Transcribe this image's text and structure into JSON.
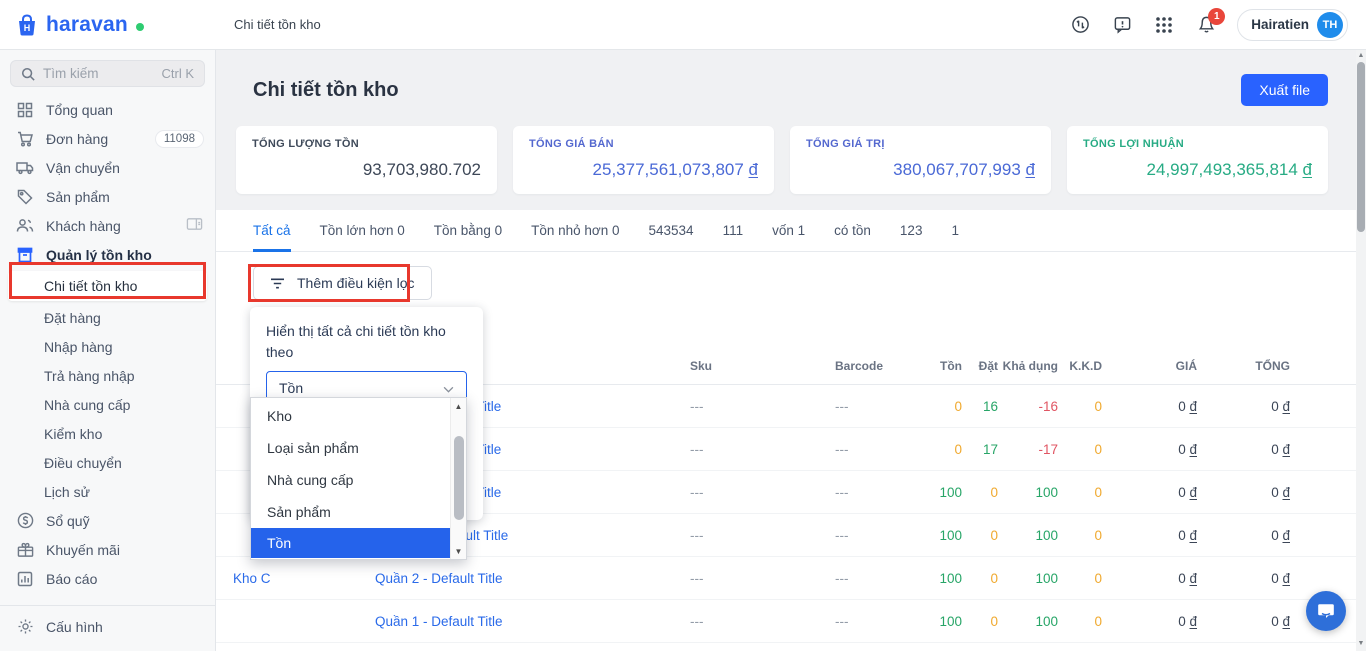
{
  "topbar": {
    "logo_text": "haravan",
    "breadcrumb": "Chi tiết tồn kho",
    "icons": [
      "history-icon",
      "feedback-icon",
      "apps-grid-icon",
      "bell-icon"
    ],
    "notification_count": "1",
    "user_name": "Hairatien",
    "user_initials": "TH"
  },
  "sidebar": {
    "search_placeholder": "Tìm kiếm",
    "search_shortcut": "Ctrl K",
    "items": [
      {
        "label": "Tổng quan",
        "icon": "dashboard-icon"
      },
      {
        "label": "Đơn hàng",
        "icon": "cart-icon",
        "badge": "11098"
      },
      {
        "label": "Vận chuyển",
        "icon": "truck-icon"
      },
      {
        "label": "Sản phẩm",
        "icon": "tag-icon"
      },
      {
        "label": "Khách hàng",
        "icon": "users-icon",
        "trailing_icon": "popout-icon"
      },
      {
        "label": "Quản lý tồn kho",
        "icon": "inventory-icon",
        "parent_active": true
      },
      {
        "label": "Chi tiết tồn kho",
        "child": true,
        "active": true
      },
      {
        "label": "Đặt hàng",
        "child": true
      },
      {
        "label": "Nhập hàng",
        "child": true
      },
      {
        "label": "Trả hàng nhập",
        "child": true
      },
      {
        "label": "Nhà cung cấp",
        "child": true
      },
      {
        "label": "Kiểm kho",
        "child": true
      },
      {
        "label": "Điều chuyển",
        "child": true
      },
      {
        "label": "Lịch sử",
        "child": true
      },
      {
        "label": "Sổ quỹ",
        "icon": "coin-icon"
      },
      {
        "label": "Khuyến mãi",
        "icon": "promo-icon"
      },
      {
        "label": "Báo cáo",
        "icon": "report-icon"
      }
    ],
    "footer_item": {
      "label": "Cấu hình",
      "icon": "gear-icon"
    }
  },
  "page": {
    "title": "Chi tiết tồn kho",
    "export_label": "Xuất file"
  },
  "stats": [
    {
      "label": "TỔNG LƯỢNG TỒN",
      "value": "93,703,980.702",
      "currency": "",
      "label_color": "#3f4a5a",
      "value_color": "#3d4757"
    },
    {
      "label": "TỔNG GIÁ BÁN",
      "value": "25,377,561,073,807",
      "currency": "đ",
      "label_color": "#5468cf",
      "value_color": "#4a69d6"
    },
    {
      "label": "TỔNG GIÁ TRỊ",
      "value": "380,067,707,993",
      "currency": "đ",
      "label_color": "#5468cf",
      "value_color": "#4a69d6"
    },
    {
      "label": "TỔNG LỢI NHUẬN",
      "value": "24,997,493,365,814",
      "currency": "đ",
      "label_color": "#27ab84",
      "value_color": "#27ab84"
    }
  ],
  "tabs": [
    "Tất cả",
    "Tồn lớn hơn 0",
    "Tồn bằng 0",
    "Tồn nhỏ hơn 0",
    "543534",
    "111",
    "vốn 1",
    "có tồn",
    "123",
    "1"
  ],
  "active_tab": "Tất cả",
  "filter": {
    "button_label": "Thêm điều kiện lọc"
  },
  "popup": {
    "label": "Hiển thị tất cả chi tiết tồn kho theo",
    "select_value": "Tồn",
    "options": [
      "Kho",
      "Loại sản phẩm",
      "Nhà cung cấp",
      "Sản phẩm",
      "Tồn"
    ],
    "selected_option": "Tồn"
  },
  "table": {
    "headers": [
      "",
      "",
      "Sku",
      "Barcode",
      "Tồn",
      "Đặt",
      "Khả dụng",
      "K.K.D",
      "GIÁ",
      "TỔNG"
    ],
    "currency": "đ",
    "rows": [
      {
        "kho": "",
        "product": "lt Title",
        "sku": "---",
        "barcode": "---",
        "ton": 0,
        "dat": 16,
        "kha_dung": -16,
        "kkd": 0,
        "gia": "0",
        "tong": "0"
      },
      {
        "kho": "",
        "product": "lt Title",
        "sku": "---",
        "barcode": "---",
        "ton": 0,
        "dat": 17,
        "kha_dung": -17,
        "kkd": 0,
        "gia": "0",
        "tong": "0"
      },
      {
        "kho": "",
        "product": "lt Title",
        "sku": "---",
        "barcode": "---",
        "ton": 100,
        "dat": 0,
        "kha_dung": 100,
        "kkd": 0,
        "gia": "0",
        "tong": "0"
      },
      {
        "kho": "",
        "product": "ault Title",
        "sku": "---",
        "barcode": "---",
        "ton": 100,
        "dat": 0,
        "kha_dung": 100,
        "kkd": 0,
        "gia": "0",
        "tong": "0"
      },
      {
        "kho": "Kho C",
        "product": "Quần 2 - Default Title",
        "sku": "---",
        "barcode": "---",
        "ton": 100,
        "dat": 0,
        "kha_dung": 100,
        "kkd": 0,
        "gia": "0",
        "tong": "0"
      },
      {
        "kho": "",
        "product": "Quần 1 - Default Title",
        "sku": "---",
        "barcode": "---",
        "ton": 100,
        "dat": 0,
        "kha_dung": 100,
        "kkd": 0,
        "gia": "0",
        "tong": "0"
      }
    ]
  },
  "colors": {
    "accent": "#2962ff",
    "positive": "#27a567",
    "zero": "#f0a92e",
    "negative": "#e05563",
    "annotation": "#e8382d",
    "selected_option_bg": "#2563eb"
  }
}
